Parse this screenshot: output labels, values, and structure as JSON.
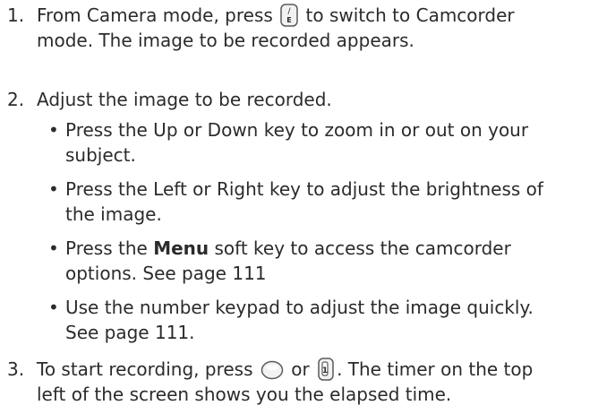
{
  "steps": [
    {
      "number": "1.",
      "line1_before": "From Camera mode, press ",
      "line1_after": " to switch to Camcorder",
      "line2": "mode. The image to be recorded appears.",
      "key_icon": "camera-mode-key-icon",
      "key_glyph_top": "/",
      "key_glyph_bottom": "E"
    },
    {
      "number": "2.",
      "text": "Adjust the image to be recorded.",
      "bullets": [
        {
          "line1": "Press the Up or Down key to zoom in or out on your",
          "line2": "subject."
        },
        {
          "line1": "Press the Left or Right key to adjust the brightness of",
          "line2": "the image."
        },
        {
          "line1_before": "Press the ",
          "line1_bold": "Menu",
          "line1_after": " soft key to access the camcorder",
          "line2": "options. See page 111"
        },
        {
          "line1": "Use the number keypad to adjust the image quickly.",
          "line2": "See page 111."
        }
      ],
      "bullet_char": "•"
    },
    {
      "number": "3.",
      "line1_before": "To start recording, press ",
      "line1_mid": " or ",
      "line1_after": ". The timer on the top",
      "line2": "left of the screen shows you the elapsed time.",
      "ok_icon": "round-ok-key-icon",
      "camera_icon": "side-camera-key-icon",
      "camera_glyph": "1"
    }
  ],
  "colors": {
    "text": "#2b2b2b",
    "icon_stroke": "#5a5a5a",
    "icon_fill": "#f2f2f2"
  }
}
